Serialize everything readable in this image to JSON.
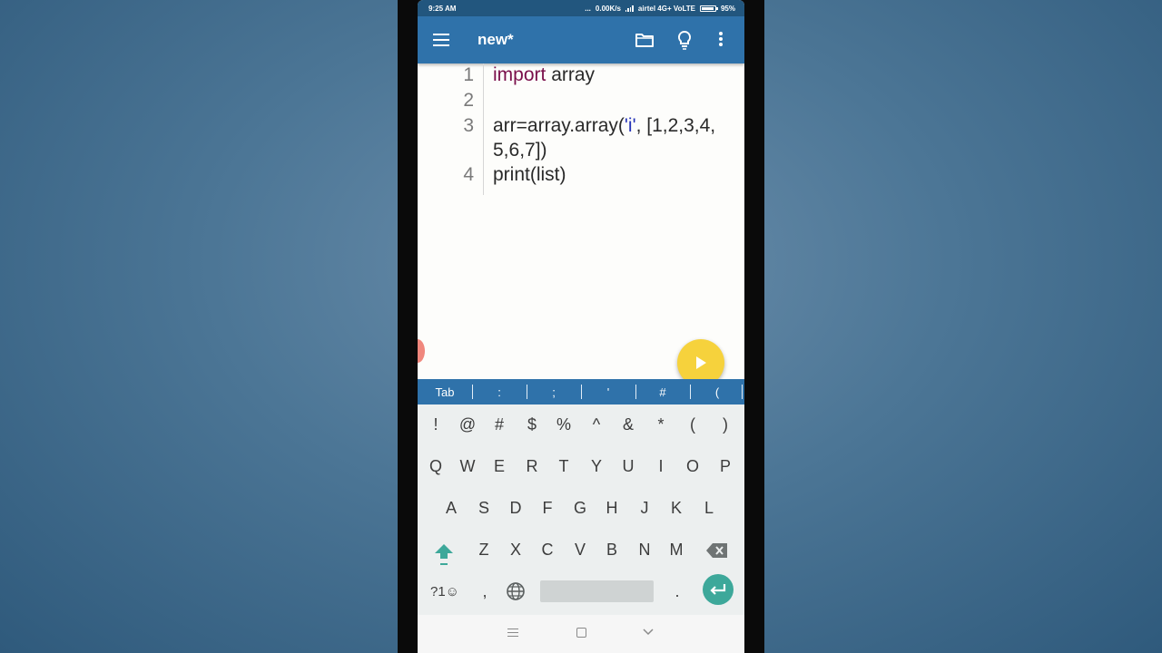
{
  "status_bar": {
    "time": "9:25 AM",
    "dots": "...",
    "network_speed": "0.00K/s",
    "carrier": "airtel 4G+ VoLTE",
    "battery": "95%",
    "battery_level": 0.95
  },
  "app_bar": {
    "menu_icon": "hamburger-menu-icon",
    "title": "new*",
    "folder_icon": "folder-icon",
    "bulb_icon": "lightbulb-icon",
    "more_icon": "more-vertical-icon"
  },
  "editor": {
    "lines": [
      {
        "num": "1",
        "keyword": "import",
        "text": " array"
      },
      {
        "num": "2",
        "text": ""
      },
      {
        "num": "3",
        "pre": "arr=array.array(",
        "string": "'i'",
        "post": ", [1,2,3,4,",
        "wrap": "5,6,7])"
      },
      {
        "num": "4",
        "text": "print(list)"
      }
    ]
  },
  "run_button_icon": "play-icon",
  "symbol_bar": [
    "Tab",
    ":",
    ";",
    "'",
    "#",
    "("
  ],
  "keyboard": {
    "row_symbols": [
      "!",
      "@",
      "#",
      "$",
      "%",
      "^",
      "&",
      "*",
      "(",
      ")"
    ],
    "row1": [
      "Q",
      "W",
      "E",
      "R",
      "T",
      "Y",
      "U",
      "I",
      "O",
      "P"
    ],
    "row2": [
      "A",
      "S",
      "D",
      "F",
      "G",
      "H",
      "J",
      "K",
      "L"
    ],
    "row3": [
      "Z",
      "X",
      "C",
      "V",
      "B",
      "N",
      "M"
    ],
    "symbols_key": "?1☺",
    "comma": ",",
    "period": ".",
    "shift_icon": "shift-arrow-icon",
    "backspace_icon": "backspace-icon",
    "globe_icon": "globe-icon",
    "enter_icon": "enter-arrow-icon"
  },
  "nav_bar": {
    "menu_icon": "recent-apps-icon",
    "home_icon": "home-square-icon",
    "back_icon": "back-chevron-icon"
  },
  "colors": {
    "app_bar": "#2f72aa",
    "status_bar": "#22567e",
    "keyword": "#7a0f4b",
    "string": "#2432b8",
    "fab": "#f6d23c",
    "enter_key": "#3da89a",
    "keyboard_bg": "#ecefef"
  }
}
